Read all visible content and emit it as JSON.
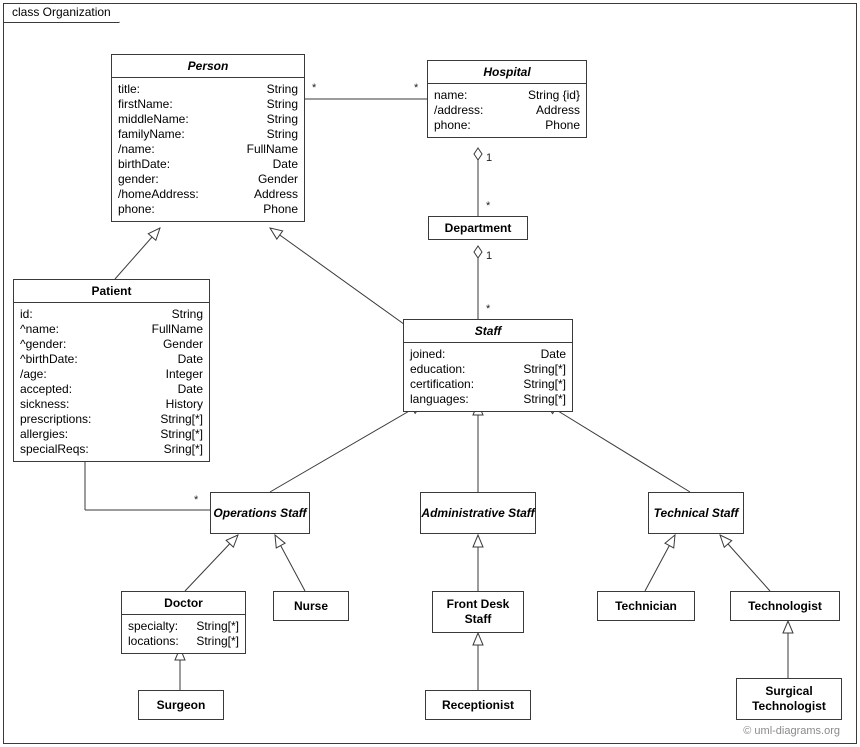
{
  "frame": {
    "label": "class Organization"
  },
  "watermark": "© uml-diagrams.org",
  "classes": {
    "person": {
      "title": "Person",
      "attrs": [
        [
          "title:",
          "String"
        ],
        [
          "firstName:",
          "String"
        ],
        [
          "middleName:",
          "String"
        ],
        [
          "familyName:",
          "String"
        ],
        [
          "/name:",
          "FullName"
        ],
        [
          "birthDate:",
          "Date"
        ],
        [
          "gender:",
          "Gender"
        ],
        [
          "/homeAddress:",
          "Address"
        ],
        [
          "phone:",
          "Phone"
        ]
      ]
    },
    "hospital": {
      "title": "Hospital",
      "attrs": [
        [
          "name:",
          "String {id}"
        ],
        [
          "/address:",
          "Address"
        ],
        [
          "phone:",
          "Phone"
        ]
      ]
    },
    "department": {
      "title": "Department"
    },
    "patient": {
      "title": "Patient",
      "attrs": [
        [
          "id:",
          "String"
        ],
        [
          "^name:",
          "FullName"
        ],
        [
          "^gender:",
          "Gender"
        ],
        [
          "^birthDate:",
          "Date"
        ],
        [
          "/age:",
          "Integer"
        ],
        [
          "accepted:",
          "Date"
        ],
        [
          "sickness:",
          "History"
        ],
        [
          "prescriptions:",
          "String[*]"
        ],
        [
          "allergies:",
          "String[*]"
        ],
        [
          "specialReqs:",
          "Sring[*]"
        ]
      ]
    },
    "staff": {
      "title": "Staff",
      "attrs": [
        [
          "joined:",
          "Date"
        ],
        [
          "education:",
          "String[*]"
        ],
        [
          "certification:",
          "String[*]"
        ],
        [
          "languages:",
          "String[*]"
        ]
      ]
    },
    "opsStaff": {
      "title": "Operations Staff"
    },
    "adminStaff": {
      "title": "Administrative Staff"
    },
    "techStaff": {
      "title": "Technical Staff"
    },
    "doctor": {
      "title": "Doctor",
      "attrs": [
        [
          "specialty:",
          "String[*]"
        ],
        [
          "locations:",
          "String[*]"
        ]
      ]
    },
    "nurse": {
      "title": "Nurse"
    },
    "frontDesk": {
      "title": "Front Desk Staff"
    },
    "receptionist": {
      "title": "Receptionist"
    },
    "technician": {
      "title": "Technician"
    },
    "technologist": {
      "title": "Technologist"
    },
    "surgTech": {
      "title": "Surgical Technologist"
    }
  },
  "multiplicities": {
    "m1": "*",
    "m2": "*",
    "m3": "1",
    "m4": "*",
    "m5": "1",
    "m6": "*",
    "m7": "*",
    "m8": "*"
  }
}
